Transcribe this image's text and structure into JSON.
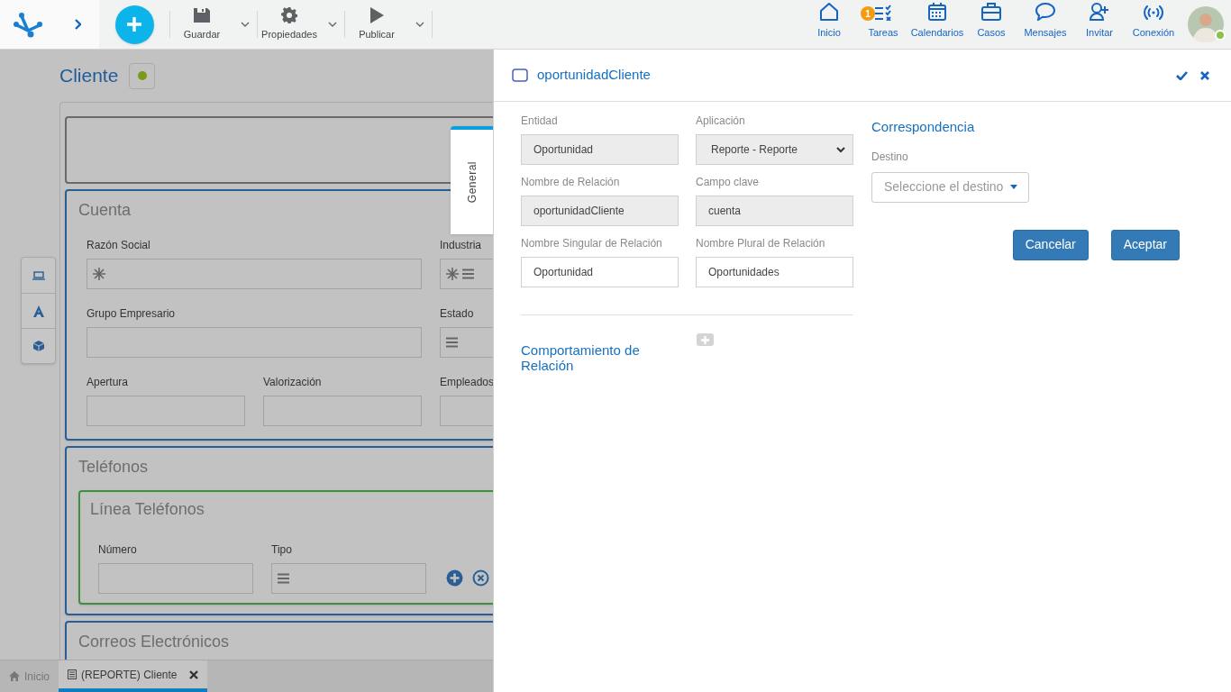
{
  "toolbar": [
    {
      "kind": "save",
      "label": "Guardar"
    },
    {
      "kind": "settings",
      "label": "Propiedades"
    },
    {
      "kind": "publish",
      "label": "Publicar"
    }
  ],
  "nav": [
    {
      "kind": "home",
      "label": "Inicio"
    },
    {
      "kind": "tasks",
      "label": "Tareas",
      "badge": "1"
    },
    {
      "kind": "calendar",
      "label": "Calendarios"
    },
    {
      "kind": "cases",
      "label": "Casos"
    },
    {
      "kind": "messages",
      "label": "Mensajes"
    },
    {
      "kind": "invite",
      "label": "Invitar"
    },
    {
      "kind": "connection",
      "label": "Conexión"
    }
  ],
  "user": {
    "online": true
  },
  "form": {
    "title": "Cliente",
    "sections": [
      {
        "kind": "blank"
      },
      {
        "kind": "group",
        "title": "Cuenta",
        "rows": [
          [
            {
              "label": "Razón Social",
              "required": true,
              "list": false
            },
            {
              "label": "Industria",
              "required": true,
              "list": true
            }
          ],
          [
            {
              "label": "Grupo Empresario",
              "required": false,
              "list": false
            },
            {
              "label": "Estado",
              "required": false,
              "list": true
            }
          ],
          [
            {
              "label": "Apertura",
              "required": false,
              "list": false
            },
            {
              "label": "Valorización",
              "required": false,
              "list": false
            },
            {
              "label": "Empleados",
              "required": false,
              "list": false
            }
          ]
        ]
      },
      {
        "kind": "grid",
        "title": "Teléfonos",
        "line_title": "Línea Teléfonos",
        "fields": [
          {
            "label": "Número",
            "required": false,
            "list": false
          },
          {
            "label": "Tipo",
            "required": false,
            "list": true
          }
        ]
      },
      {
        "kind": "grid",
        "title": "Correos Electrónicos"
      }
    ]
  },
  "side_tab": {
    "label": "General",
    "selected": true
  },
  "bottom_tabs": [
    {
      "kind": "home",
      "label": "Inicio",
      "selected": false
    },
    {
      "kind": "document",
      "label": "(REPORTE) Cliente",
      "selected": true
    }
  ],
  "panel": {
    "title": "oportunidadCliente",
    "fields": [
      {
        "label": "Entidad",
        "value": "Oportunidad",
        "kind": "readonly"
      },
      {
        "label": "Aplicación",
        "value": "Reporte - Reporte",
        "kind": "select"
      },
      {
        "label": "Nombre de Relación",
        "value": "oportunidadCliente",
        "kind": "readonly"
      },
      {
        "label": "Campo clave",
        "value": "cuenta",
        "kind": "readonly"
      },
      {
        "label": "Nombre Singular de Relación",
        "value": "Oportunidad",
        "kind": "input"
      },
      {
        "label": "Nombre Plural de Relación",
        "value": "Oportunidades",
        "kind": "input"
      }
    ],
    "behavior_title": "Comportamiento de Relación",
    "correspondence": {
      "title": "Correspondencia",
      "label": "Destino",
      "prompt": "Seleccione el destino"
    },
    "buttons": [
      {
        "label": "Cancelar"
      },
      {
        "label": "Aceptar"
      }
    ]
  }
}
